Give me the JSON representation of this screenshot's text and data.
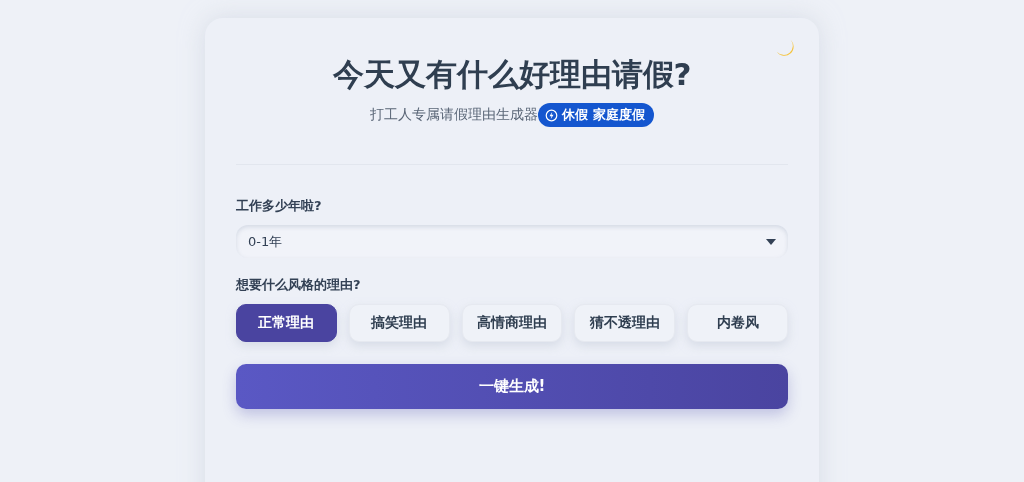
{
  "title": "今天又有什么好理由请假?",
  "subtitle": "打工人专属请假理由生成器",
  "badge": {
    "text": "休假 家庭度假"
  },
  "years": {
    "label": "工作多少年啦?",
    "value": "0-1年"
  },
  "style": {
    "label": "想要什么风格的理由?",
    "options": [
      {
        "label": "正常理由",
        "selected": true
      },
      {
        "label": "搞笑理由",
        "selected": false
      },
      {
        "label": "高情商理由",
        "selected": false
      },
      {
        "label": "猜不透理由",
        "selected": false
      },
      {
        "label": "内卷风",
        "selected": false
      }
    ]
  },
  "generate_button": "一键生成!"
}
